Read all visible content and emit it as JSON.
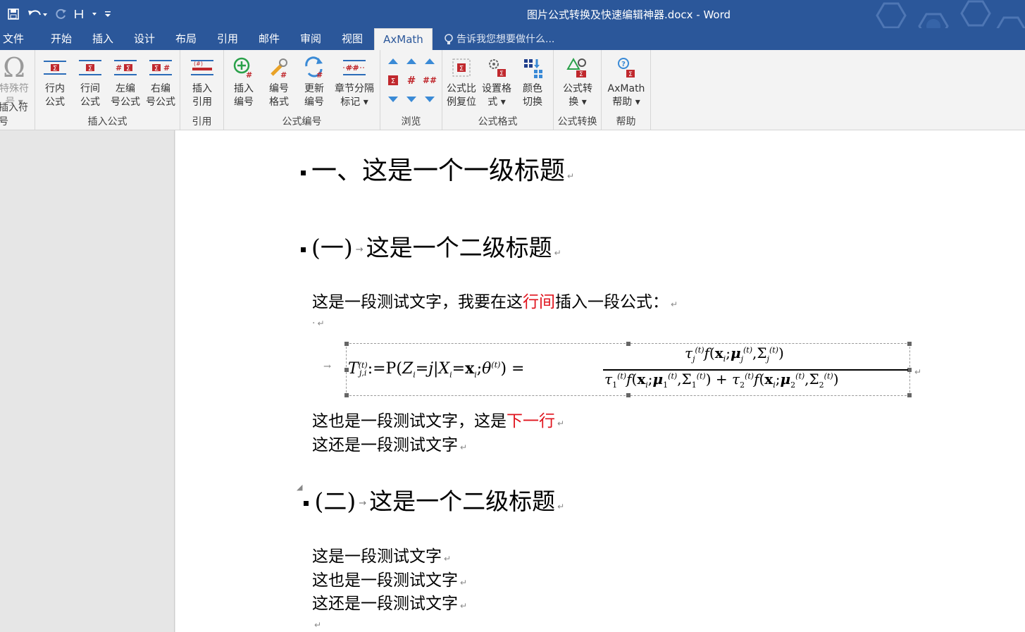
{
  "window": {
    "title": "图片公式转换及快速编辑神器.docx - Word"
  },
  "tabs": [
    "文件",
    "开始",
    "插入",
    "设计",
    "布局",
    "引用",
    "邮件",
    "审阅",
    "视图",
    "AxMath"
  ],
  "tell_me": "告诉我您想要做什么...",
  "ribbon": {
    "special": {
      "label1": "特殊符",
      "label2": "号",
      "group": "插入符号"
    },
    "insert_formula": {
      "group": "插入公式",
      "buttons": [
        {
          "l1": "行内",
          "l2": "公式"
        },
        {
          "l1": "行间",
          "l2": "公式"
        },
        {
          "l1": "左编",
          "l2": "号公式"
        },
        {
          "l1": "右编",
          "l2": "号公式"
        }
      ]
    },
    "cite": {
      "group": "引用",
      "l1": "插入",
      "l2": "引用"
    },
    "numbering": {
      "group": "公式编号",
      "buttons": [
        {
          "l1": "插入",
          "l2": "编号"
        },
        {
          "l1": "编号",
          "l2": "格式"
        },
        {
          "l1": "更新",
          "l2": "编号"
        },
        {
          "l1": "章节分隔",
          "l2": "标记"
        }
      ]
    },
    "browse": {
      "group": "浏览"
    },
    "format": {
      "group": "公式格式",
      "buttons": [
        {
          "l1": "公式比",
          "l2": "例复位"
        },
        {
          "l1": "设置格",
          "l2": "式"
        },
        {
          "l1": "颜色",
          "l2": "切换"
        }
      ]
    },
    "convert": {
      "group": "公式转换",
      "l1": "公式转",
      "l2": "换"
    },
    "help": {
      "group": "帮助",
      "l1": "AxMath",
      "l2": "帮助"
    }
  },
  "document": {
    "h1": "一、这是一个一级标题",
    "h2a_num": "(一)",
    "h2a_text": "这是一个二级标题",
    "p1_pre": "这是一段测试文字，我要在这",
    "p1_red": "行间",
    "p1_post": "插入一段公式：",
    "p2_pre": "这也是一段测试文字，这是",
    "p2_red": "下一行",
    "p3": "这还是一段测试文字",
    "h2b_num": "(二)",
    "h2b_text": "这是一个二级标题",
    "p4": "这是一段测试文字",
    "p5": "这也是一段测试文字",
    "p6": "这还是一段测试文字",
    "para_mark": "↵"
  },
  "colors": {
    "title_bar": "#2b579a",
    "ribbon": "#f3f3f3",
    "highlight_red": "#e0141e"
  }
}
